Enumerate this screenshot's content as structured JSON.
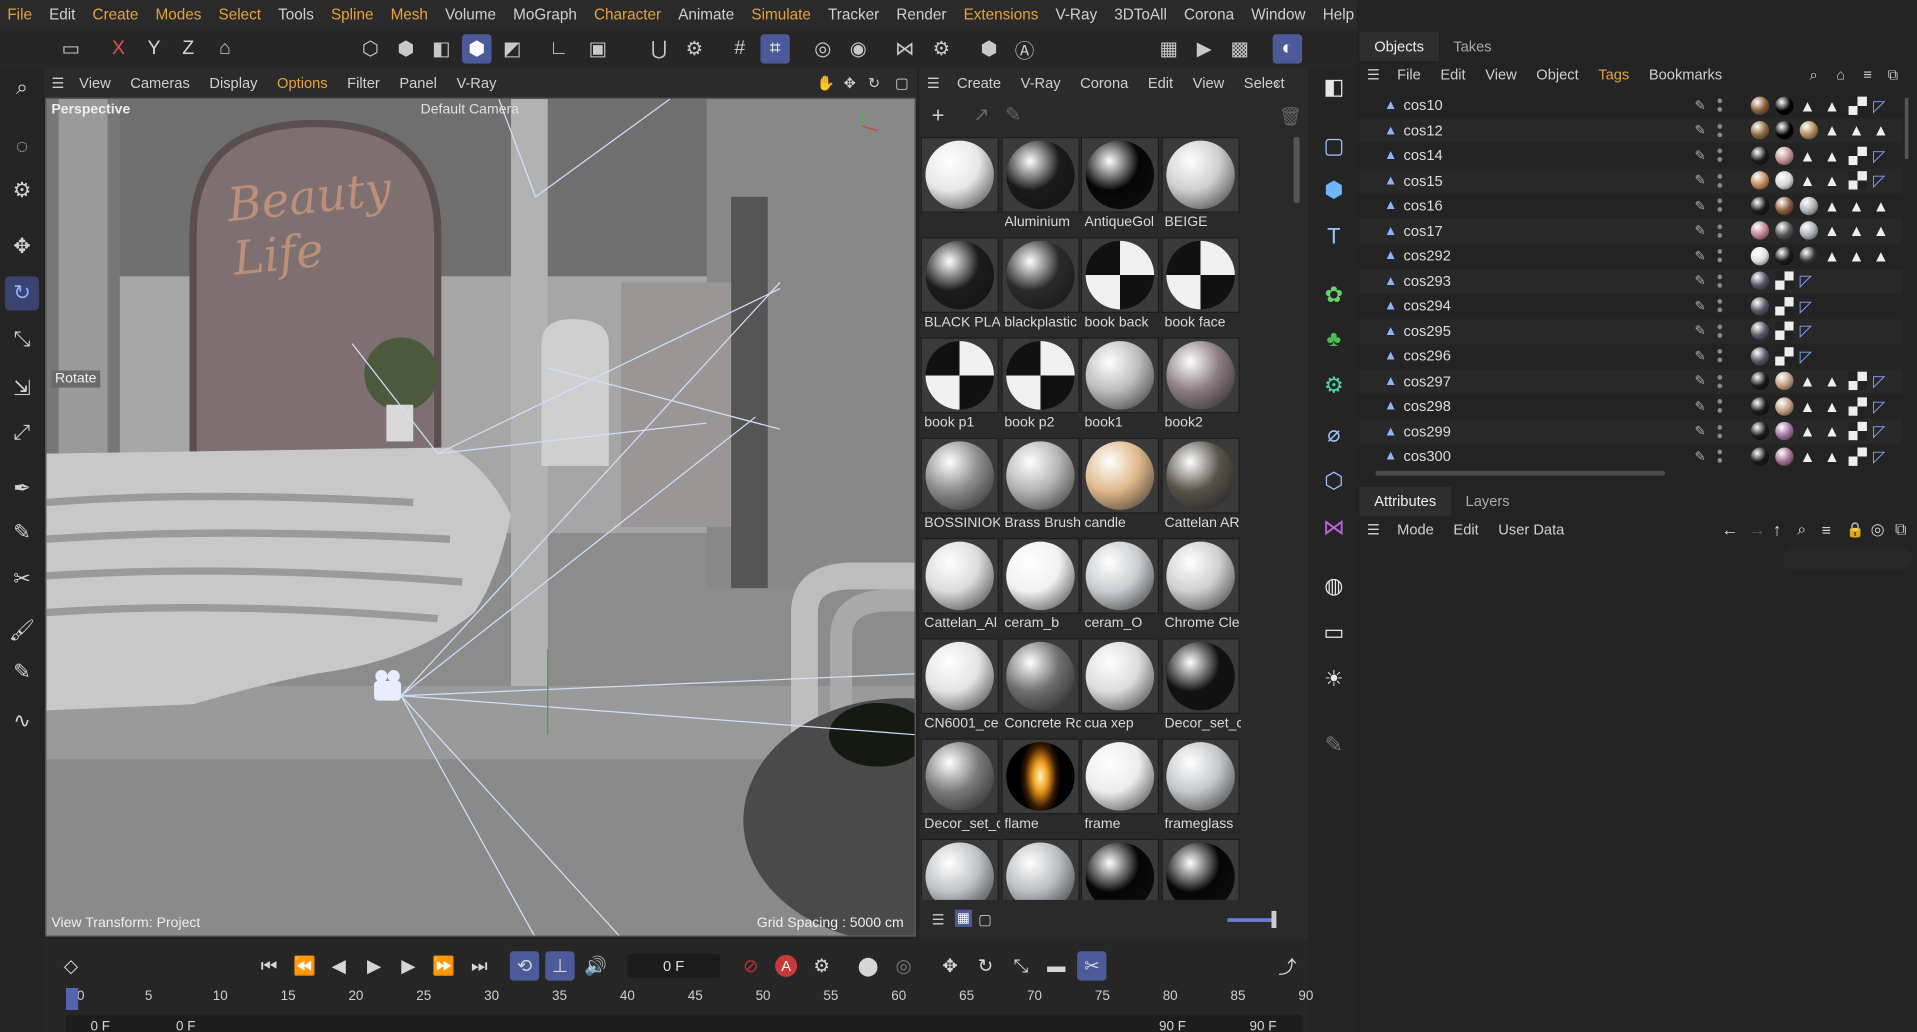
{
  "menu": [
    "File",
    "Edit",
    "Create",
    "Modes",
    "Select",
    "Tools",
    "Spline",
    "Mesh",
    "Volume",
    "MoGraph",
    "Character",
    "Animate",
    "Simulate",
    "Tracker",
    "Render",
    "Extensions",
    "V-Ray",
    "3DToAll",
    "Corona",
    "Window",
    "Help"
  ],
  "axes": {
    "x": "X",
    "y": "Y",
    "z": "Z"
  },
  "viewport": {
    "menu": [
      "View",
      "Cameras",
      "Display",
      "Options",
      "Filter",
      "Panel",
      "V-Ray"
    ],
    "name": "Perspective",
    "camera": "Default Camera",
    "tool_label": "Rotate",
    "transform": "View Transform: Project",
    "grid": "Grid Spacing : 5000 cm",
    "sign_text": "Beauty Life"
  },
  "materials": {
    "menu": [
      "Create",
      "V-Ray",
      "Corona",
      "Edit",
      "View",
      "Select"
    ],
    "items": [
      {
        "name": "",
        "tone": "#e8e8e8"
      },
      {
        "name": "Aluminium",
        "tone": "#1a1a1a"
      },
      {
        "name": "AntiqueGol",
        "tone": "#050505"
      },
      {
        "name": "BEIGE",
        "tone": "#cfcfcf"
      },
      {
        "name": "BLACK PLA!",
        "tone": "#1b1b1b"
      },
      {
        "name": "blackplastic",
        "tone": "#2a2a2a"
      },
      {
        "name": "book back",
        "tone": "checker"
      },
      {
        "name": "book face",
        "tone": "checker"
      },
      {
        "name": "book p1",
        "tone": "checker"
      },
      {
        "name": "book p2",
        "tone": "checker"
      },
      {
        "name": "book1",
        "tone": "#bdbdbd"
      },
      {
        "name": "book2",
        "tone": "#8a7c80"
      },
      {
        "name": "BOSSINIOK",
        "tone": "#8c8c8c"
      },
      {
        "name": "Brass Brush",
        "tone": "#b4b4b4"
      },
      {
        "name": "candle",
        "tone": "#e0b98c"
      },
      {
        "name": "Cattelan AR",
        "tone": "#5a5248"
      },
      {
        "name": "Cattelan_Al",
        "tone": "#dcdcdc"
      },
      {
        "name": "ceram_b",
        "tone": "#f2f2f2"
      },
      {
        "name": "ceram_O",
        "tone": "#c9cdd2"
      },
      {
        "name": "Chrome Cle",
        "tone": "#d0d0d0"
      },
      {
        "name": "CN6001_ce",
        "tone": "#e4e4e4"
      },
      {
        "name": "Concrete Rc",
        "tone": "#6e6e6e"
      },
      {
        "name": "cua xep",
        "tone": "#dddddd"
      },
      {
        "name": "Decor_set_c",
        "tone": "#111111"
      },
      {
        "name": "Decor_set_c",
        "tone": "#7a7a7a"
      },
      {
        "name": "flame",
        "tone": "flame"
      },
      {
        "name": "frame",
        "tone": "#ededed"
      },
      {
        "name": "frameglass",
        "tone": "#c4c8cc"
      },
      {
        "name": "",
        "tone": "#bfc3c7"
      },
      {
        "name": "",
        "tone": "#b9bdc1"
      },
      {
        "name": "",
        "tone": "#050505"
      },
      {
        "name": "",
        "tone": "#060606"
      }
    ]
  },
  "objects_panel": {
    "tabs": [
      "Objects",
      "Takes"
    ],
    "menu": [
      "File",
      "Edit",
      "View",
      "Object",
      "Tags",
      "Bookmarks"
    ],
    "rows": [
      "cos10",
      "cos12",
      "cos14",
      "cos15",
      "cos16",
      "cos17",
      "cos292",
      "cos293",
      "cos294",
      "cos295",
      "cos296",
      "cos297",
      "cos298",
      "cos299",
      "cos300"
    ]
  },
  "attributes": {
    "tabs": [
      "Attributes",
      "Layers"
    ],
    "menu": [
      "Mode",
      "Edit",
      "User Data"
    ]
  },
  "timeline": {
    "current_frame": "0 F",
    "ruler": [
      "0",
      "5",
      "10",
      "15",
      "20",
      "25",
      "30",
      "35",
      "40",
      "45",
      "50",
      "55",
      "60",
      "65",
      "70",
      "75",
      "80",
      "85",
      "90"
    ],
    "start": "0 F",
    "start2": "0 F",
    "end": "90 F",
    "end2": "90 F"
  }
}
